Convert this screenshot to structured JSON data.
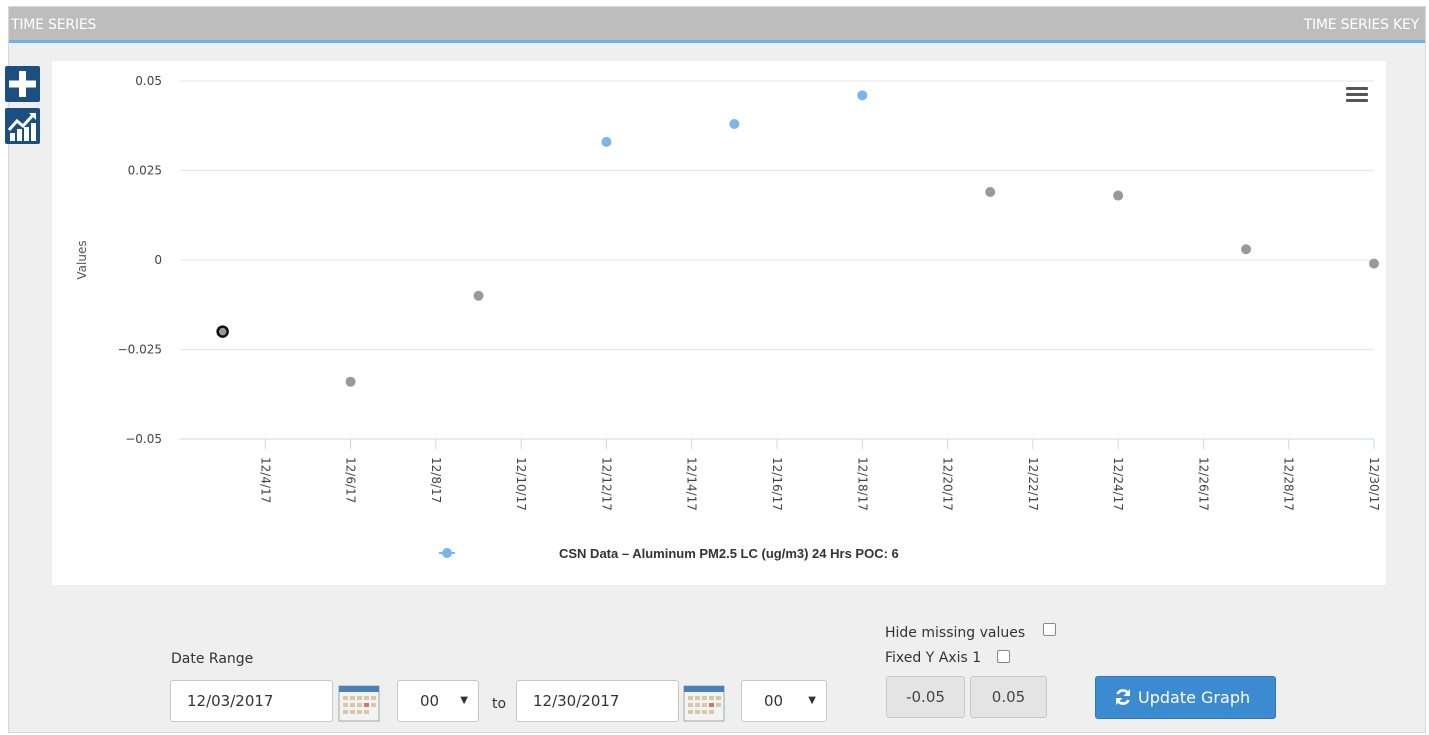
{
  "header": {
    "left_title": "TIME SERIES",
    "right_title": "TIME SERIES KEY"
  },
  "side_buttons": [
    {
      "icon": "plus-icon",
      "color": "#1b4f80"
    },
    {
      "icon": "chart-trend-icon",
      "color": "#1b4f80"
    }
  ],
  "chart_data": {
    "type": "scatter",
    "title": "",
    "xlabel": "",
    "ylabel": "Values",
    "ylim": [
      -0.05,
      0.05
    ],
    "y_ticks": [
      "0.05",
      "0.025",
      "0",
      "−0.025",
      "−0.05"
    ],
    "y_tick_values": [
      0.05,
      0.025,
      0,
      -0.025,
      -0.05
    ],
    "xlim": [
      "2017-12-02",
      "2017-12-30"
    ],
    "x_ticks": [
      "12/4/17",
      "12/6/17",
      "12/8/17",
      "12/10/17",
      "12/12/17",
      "12/14/17",
      "12/16/17",
      "12/18/17",
      "12/20/17",
      "12/22/17",
      "12/24/17",
      "12/26/17",
      "12/28/17",
      "12/30/17"
    ],
    "x_tick_values": [
      "2017-12-04",
      "2017-12-06",
      "2017-12-08",
      "2017-12-10",
      "2017-12-12",
      "2017-12-14",
      "2017-12-16",
      "2017-12-18",
      "2017-12-20",
      "2017-12-22",
      "2017-12-24",
      "2017-12-26",
      "2017-12-28",
      "2017-12-30"
    ],
    "grid": true,
    "legend_position": "bottom-center",
    "series": [
      {
        "name": "CSN Data – Aluminum PM2.5 LC (ug/m3) 24 Hrs POC: 6",
        "color": "#7cb5ec",
        "points": [
          {
            "x": "2017-12-03",
            "y": -0.02,
            "color": "#333333",
            "selected": true
          },
          {
            "x": "2017-12-06",
            "y": -0.034,
            "color": "#999999"
          },
          {
            "x": "2017-12-09",
            "y": -0.01,
            "color": "#999999"
          },
          {
            "x": "2017-12-12",
            "y": 0.033,
            "color": "#7cb5ec"
          },
          {
            "x": "2017-12-15",
            "y": 0.038,
            "color": "#7cb5ec"
          },
          {
            "x": "2017-12-18",
            "y": 0.046,
            "color": "#7cb5ec"
          },
          {
            "x": "2017-12-21",
            "y": 0.019,
            "color": "#999999"
          },
          {
            "x": "2017-12-24",
            "y": 0.018,
            "color": "#999999"
          },
          {
            "x": "2017-12-27",
            "y": 0.003,
            "color": "#999999"
          },
          {
            "x": "2017-12-30",
            "y": -0.001,
            "color": "#999999"
          }
        ]
      }
    ]
  },
  "controls": {
    "date_range_label": "Date Range",
    "start_date": "12/03/2017",
    "start_hour": "00",
    "to_label": "to",
    "end_date": "12/30/2017",
    "end_hour": "00",
    "hide_missing_label": "Hide missing values",
    "fixed_y_label": "Fixed Y Axis 1",
    "y_min": "-0.05",
    "y_max": "0.05",
    "update_label": "Update Graph",
    "accent_color": "#3c8bd0"
  }
}
